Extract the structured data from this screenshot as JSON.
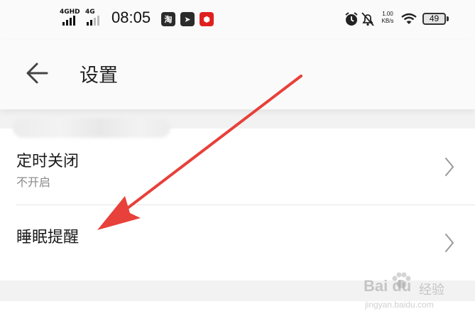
{
  "status_bar": {
    "signal_1_label": "4GHD",
    "signal_2_label": "4G",
    "time": "08:05",
    "apps": [
      {
        "name": "taobao",
        "glyph": "淘",
        "color": "#2b2b2b"
      },
      {
        "name": "telegram",
        "glyph": "➤",
        "color": "#2b2b2b"
      },
      {
        "name": "red-app",
        "glyph": "⬢",
        "color": "#e02020"
      }
    ],
    "net_speed_value": "1.00",
    "net_speed_unit": "KB/s",
    "battery": "49"
  },
  "header": {
    "title": "设置"
  },
  "settings": {
    "items": [
      {
        "title": "定时关闭",
        "subtitle": "不开启"
      },
      {
        "title": "睡眠提醒",
        "subtitle": ""
      }
    ]
  },
  "annotation": {
    "color": "#e8403a"
  },
  "watermark": {
    "brand": "Bai du",
    "label": "经验",
    "url": "jingyan.baidu.com"
  }
}
